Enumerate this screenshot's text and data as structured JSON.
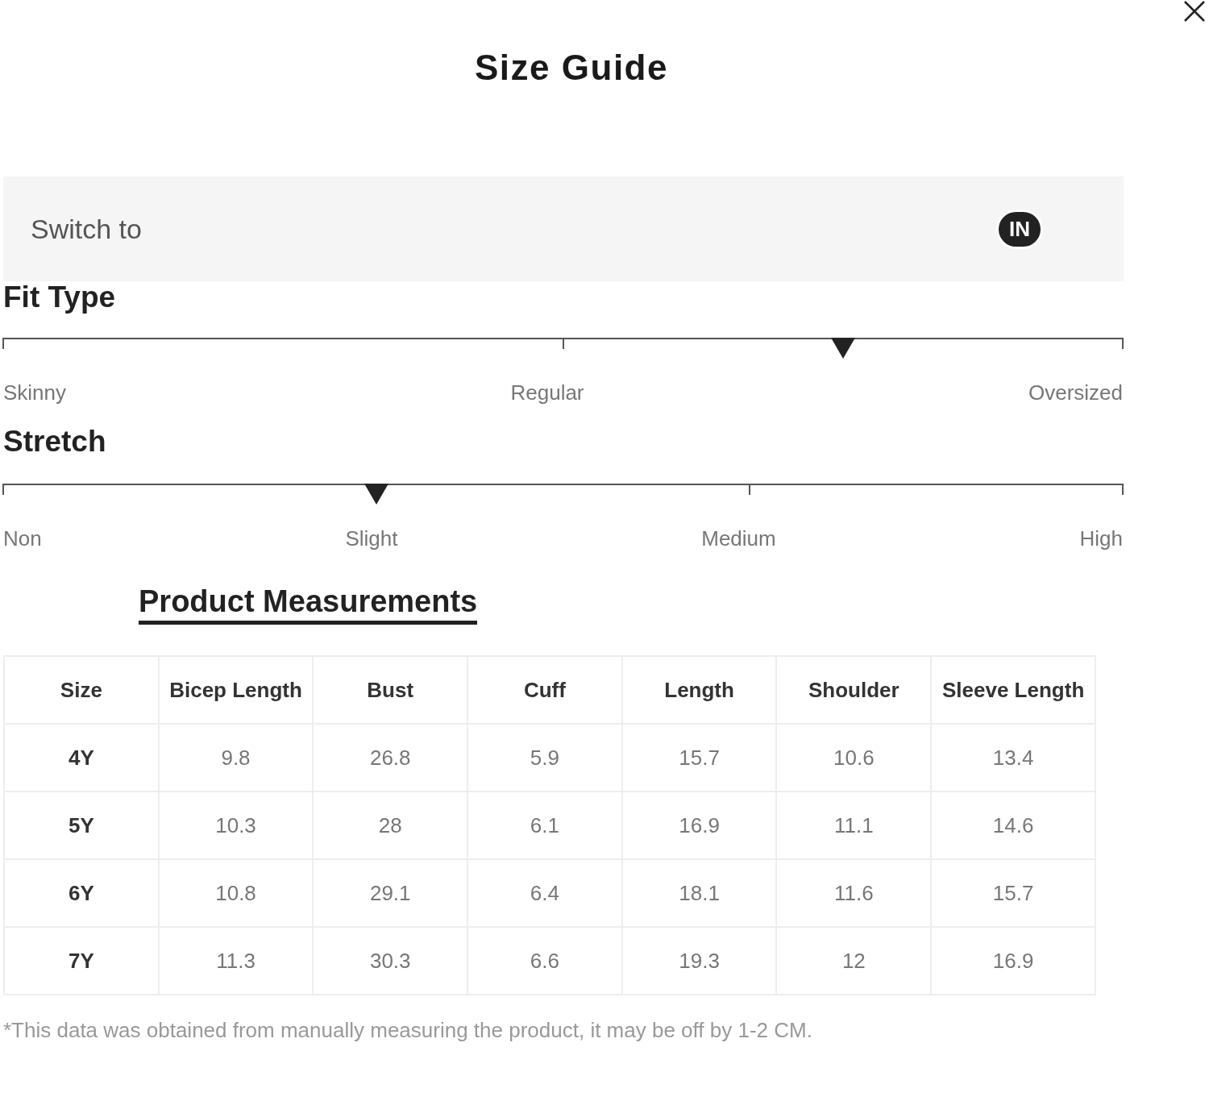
{
  "dialog": {
    "title": "Size Guide"
  },
  "unit_switch": {
    "label": "Switch to",
    "options": [
      {
        "label": "IN",
        "selected": true
      }
    ]
  },
  "scales": [
    {
      "title": "Fit Type",
      "level": 0.75,
      "labels": [
        "Skinny",
        "Regular",
        "Oversized"
      ]
    },
    {
      "title": "Stretch",
      "level": 0.333,
      "labels": [
        "Non",
        "Slight",
        "Medium",
        "High"
      ]
    }
  ],
  "measurements": {
    "tabs": [
      {
        "label": "Product Measurements",
        "selected": true
      }
    ],
    "table": {
      "columns": [
        "Size",
        "Bicep Length",
        "Bust",
        "Cuff",
        "Length",
        "Shoulder",
        "Sleeve Length"
      ],
      "rows": [
        [
          "4Y",
          "9.8",
          "26.8",
          "5.9",
          "15.7",
          "10.6",
          "13.4"
        ],
        [
          "5Y",
          "10.3",
          "28",
          "6.1",
          "16.9",
          "11.1",
          "14.6"
        ],
        [
          "6Y",
          "10.8",
          "29.1",
          "6.4",
          "18.1",
          "11.6",
          "15.7"
        ],
        [
          "7Y",
          "11.3",
          "30.3",
          "6.6",
          "19.3",
          "12",
          "16.9"
        ]
      ]
    }
  },
  "footnote": "*This data was obtained from manually measuring the product, it may be off by 1-2 CM."
}
